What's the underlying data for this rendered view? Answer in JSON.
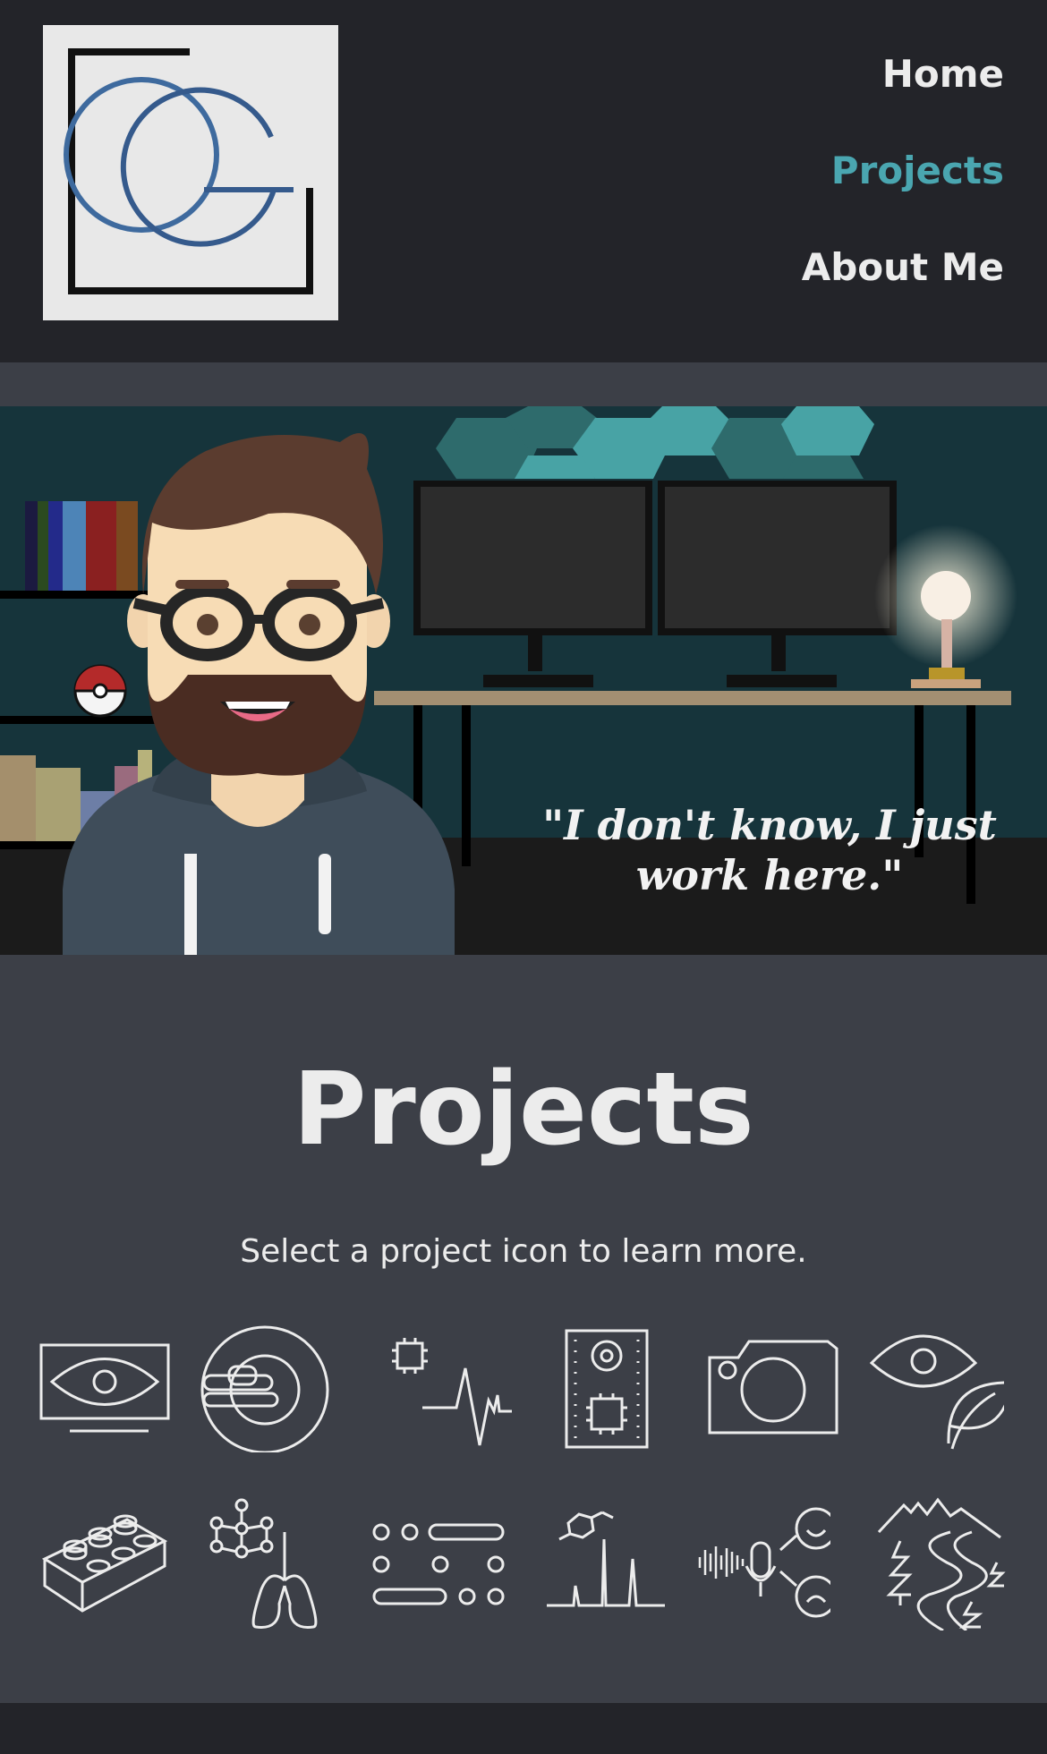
{
  "header": {
    "logo_alt": "CG",
    "nav": [
      {
        "label": "Home",
        "active": false
      },
      {
        "label": "Projects",
        "active": true
      },
      {
        "label": "About Me",
        "active": false
      }
    ],
    "active_color": "#4aa6b0"
  },
  "hero": {
    "quote": "\"I don't know, I just work here.\""
  },
  "main": {
    "title": "Projects",
    "subtitle": "Select a project icon to learn more.",
    "icons_row1": [
      "eye-monitor-icon",
      "mri-scanner-icon",
      "chip-heartbeat-icon",
      "speaker-chip-icon",
      "camera-icon",
      "eye-leaf-icon"
    ],
    "icons_row2": [
      "lego-brick-icon",
      "neural-network-lungs-icon",
      "dots-lines-icon",
      "molecule-spectrum-icon",
      "voice-emotion-icon",
      "mountain-trail-icon"
    ]
  },
  "colors": {
    "header_bg": "#232429",
    "body_bg": "#3c3f47",
    "accent": "#4aa6b0",
    "text": "#ececec"
  }
}
